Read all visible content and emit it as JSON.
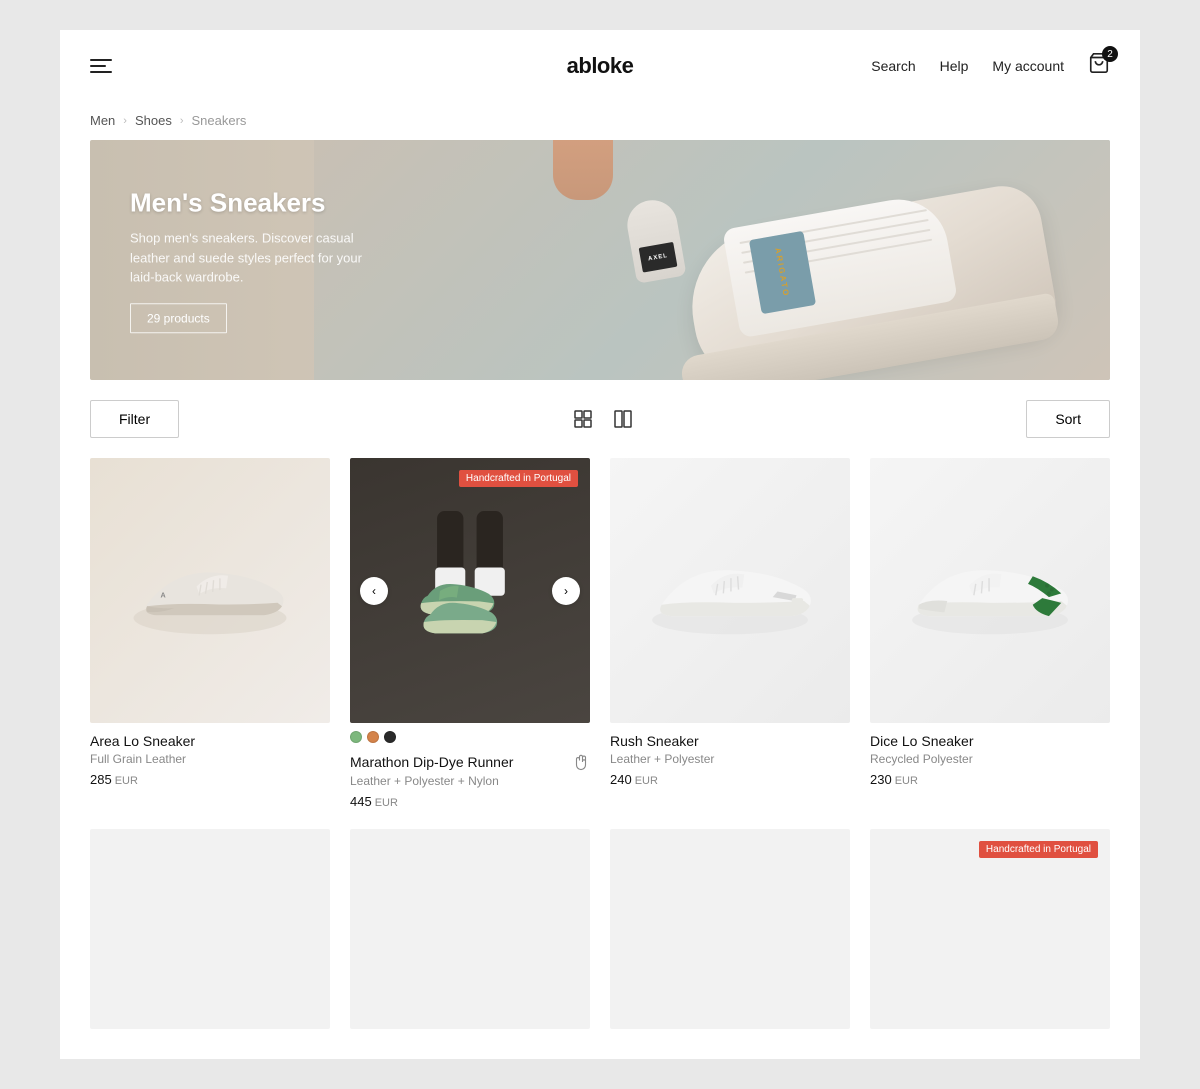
{
  "header": {
    "logo": "abloke",
    "menu_icon": "☰",
    "nav": {
      "search": "Search",
      "help": "Help",
      "account": "My account"
    },
    "cart_count": "2"
  },
  "breadcrumb": {
    "items": [
      {
        "label": "Men",
        "active": false
      },
      {
        "label": "Shoes",
        "active": false
      },
      {
        "label": "Sneakers",
        "active": true
      }
    ]
  },
  "hero": {
    "title": "Men's Sneakers",
    "description": "Shop men's sneakers. Discover casual leather and suede styles perfect for your laid-back wardrobe.",
    "cta_label": "29 products",
    "brand_label": "ARIGATO"
  },
  "toolbar": {
    "filter_label": "Filter",
    "sort_label": "Sort"
  },
  "products": [
    {
      "id": 1,
      "name": "Area Lo Sneaker",
      "material": "Full Grain Leather",
      "price": "285",
      "currency": "EUR",
      "badge": "",
      "has_swatches": false,
      "colors": []
    },
    {
      "id": 2,
      "name": "Marathon Dip-Dye Runner",
      "material": "Leather + Polyester + Nylon",
      "price": "445",
      "currency": "EUR",
      "badge": "Handcrafted in Portugal",
      "has_swatches": true,
      "colors": [
        "#7db87d",
        "#d4834a",
        "#2a2a2a"
      ]
    },
    {
      "id": 3,
      "name": "Rush Sneaker",
      "material": "Leather + Polyester",
      "price": "240",
      "currency": "EUR",
      "badge": "",
      "has_swatches": false,
      "colors": []
    },
    {
      "id": 4,
      "name": "Dice Lo Sneaker",
      "material": "Recycled Polyester",
      "price": "230",
      "currency": "EUR",
      "badge": "",
      "has_swatches": false,
      "colors": []
    }
  ],
  "partial_row": {
    "badge_last": "Handcrafted in Portugal"
  }
}
